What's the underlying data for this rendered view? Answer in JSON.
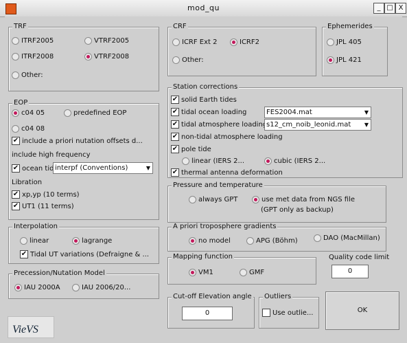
{
  "window": {
    "title": "mod_qu",
    "controls": [
      "_",
      "□",
      "X"
    ]
  },
  "trf": {
    "title": "TRF",
    "options": [
      "ITRF2005",
      "VTRF2005",
      "ITRF2008",
      "VTRF2008",
      "Other:"
    ],
    "selected": "VTRF2008"
  },
  "crf": {
    "title": "CRF",
    "options": [
      "ICRF Ext 2",
      "ICRF2",
      "Other:"
    ],
    "selected": "ICRF2"
  },
  "ephemerides": {
    "title": "Ephemerides",
    "options": [
      "JPL 405",
      "JPL 421"
    ],
    "selected": "JPL 421"
  },
  "eop": {
    "title": "EOP",
    "options": [
      "c04 05",
      "predefined EOP",
      "c04 08"
    ],
    "selected": "c04 05",
    "nutation_check": "include a priori nutation offsets d...",
    "high_freq_label": "include high frequency",
    "ocean_tide_check": "ocean tide",
    "ocean_tide_select": "interpf (Conventions)",
    "libration_label": "Libration",
    "libration_xy": "xp,yp (10 terms)",
    "libration_ut1": "UT1 (11 terms)"
  },
  "station_corrections": {
    "title": "Station corrections",
    "solid_earth": "solid Earth tides",
    "tidal_ocean": "tidal ocean loading",
    "tidal_ocean_select": "FES2004.mat",
    "tidal_atm": "tidal atmosphere loading",
    "tidal_atm_select": "s12_cm_noib_leonid.mat",
    "non_tidal_atm": "non-tidal atmosphere loading",
    "pole_tide": "pole tide",
    "pole_linear": "linear (IERS 2...",
    "pole_cubic": "cubic (IERS 2...",
    "pole_selected": "cubic (IERS 2...",
    "thermal": "thermal antenna deformation"
  },
  "pressure": {
    "title": "Pressure and temperature",
    "always_gpt": "always GPT",
    "use_met": "use met data from NGS file",
    "use_met_note": "(GPT only as backup)",
    "selected": "use met data from NGS file"
  },
  "interpolation": {
    "title": "Interpolation",
    "options": [
      "linear",
      "lagrange"
    ],
    "selected": "lagrange",
    "tidal_ut_check": "Tidal UT variations (Defraigne & ..."
  },
  "gradients": {
    "title": "A priori troposphere gradients",
    "options": [
      "no model",
      "APG (Böhm)",
      "DAO (MacMillan)"
    ],
    "selected": "no model"
  },
  "precession": {
    "title": "Precession/Nutation Model",
    "options": [
      "IAU 2000A",
      "IAU 2006/20..."
    ],
    "selected": "IAU 2000A"
  },
  "mapping": {
    "title": "Mapping function",
    "options": [
      "VM1",
      "GMF"
    ],
    "selected": "VM1"
  },
  "quality": {
    "title": "Quality code limit",
    "value": "0"
  },
  "cutoff": {
    "title": "Cut-off Elevation angle",
    "value": "0"
  },
  "outliers": {
    "title": "Outliers",
    "check": "Use outlie..."
  },
  "ok_label": "OK",
  "logo_text": "VieVS"
}
